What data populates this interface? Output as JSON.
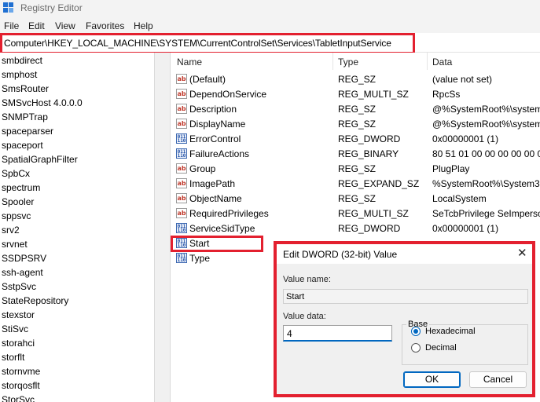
{
  "window": {
    "title": "Registry Editor"
  },
  "menu": [
    "File",
    "Edit",
    "View",
    "Favorites",
    "Help"
  ],
  "address": "Computer\\HKEY_LOCAL_MACHINE\\SYSTEM\\CurrentControlSet\\Services\\TabletInputService",
  "tree_items": [
    "smbdirect",
    "smphost",
    "SmsRouter",
    "SMSvcHost 4.0.0.0",
    "SNMPTrap",
    "spaceparser",
    "spaceport",
    "SpatialGraphFilter",
    "SpbCx",
    "spectrum",
    "Spooler",
    "sppsvc",
    "srv2",
    "srvnet",
    "SSDPSRV",
    "ssh-agent",
    "SstpSvc",
    "StateRepository",
    "stexstor",
    "StiSvc",
    "storahci",
    "storflt",
    "stornvme",
    "storqosflt",
    "StorSvc"
  ],
  "columns": {
    "name": "Name",
    "type": "Type",
    "data": "Data"
  },
  "rows": [
    {
      "name": "(Default)",
      "type": "REG_SZ",
      "data": "(value not set)",
      "icon": "string-value-icon"
    },
    {
      "name": "DependOnService",
      "type": "REG_MULTI_SZ",
      "data": "RpcSs",
      "icon": "string-value-icon"
    },
    {
      "name": "Description",
      "type": "REG_SZ",
      "data": "@%SystemRoot%\\system",
      "icon": "string-value-icon"
    },
    {
      "name": "DisplayName",
      "type": "REG_SZ",
      "data": "@%SystemRoot%\\system",
      "icon": "string-value-icon"
    },
    {
      "name": "ErrorControl",
      "type": "REG_DWORD",
      "data": "0x00000001 (1)",
      "icon": "binary-value-icon"
    },
    {
      "name": "FailureActions",
      "type": "REG_BINARY",
      "data": "80 51 01 00 00 00 00 00 0",
      "icon": "binary-value-icon"
    },
    {
      "name": "Group",
      "type": "REG_SZ",
      "data": "PlugPlay",
      "icon": "string-value-icon"
    },
    {
      "name": "ImagePath",
      "type": "REG_EXPAND_SZ",
      "data": "%SystemRoot%\\System32",
      "icon": "string-value-icon"
    },
    {
      "name": "ObjectName",
      "type": "REG_SZ",
      "data": "LocalSystem",
      "icon": "string-value-icon"
    },
    {
      "name": "RequiredPrivileges",
      "type": "REG_MULTI_SZ",
      "data": "SeTcbPrivilege SeImperso",
      "icon": "string-value-icon"
    },
    {
      "name": "ServiceSidType",
      "type": "REG_DWORD",
      "data": "0x00000001 (1)",
      "icon": "binary-value-icon"
    },
    {
      "name": "Start",
      "type": "",
      "data": "",
      "icon": "binary-value-icon"
    },
    {
      "name": "Type",
      "type": "",
      "data": "",
      "icon": "binary-value-icon"
    }
  ],
  "dialog": {
    "title": "Edit DWORD (32-bit) Value",
    "close_glyph": "✕",
    "value_name_label": "Value name:",
    "value_name": "Start",
    "value_data_label": "Value data:",
    "value_data": "4",
    "base_label": "Base",
    "hex_label": "Hexadecimal",
    "dec_label": "Decimal",
    "selected_base": "Hexadecimal",
    "ok_label": "OK",
    "cancel_label": "Cancel"
  },
  "colors": {
    "highlight": "#e3202f",
    "accent": "#0067c0"
  }
}
